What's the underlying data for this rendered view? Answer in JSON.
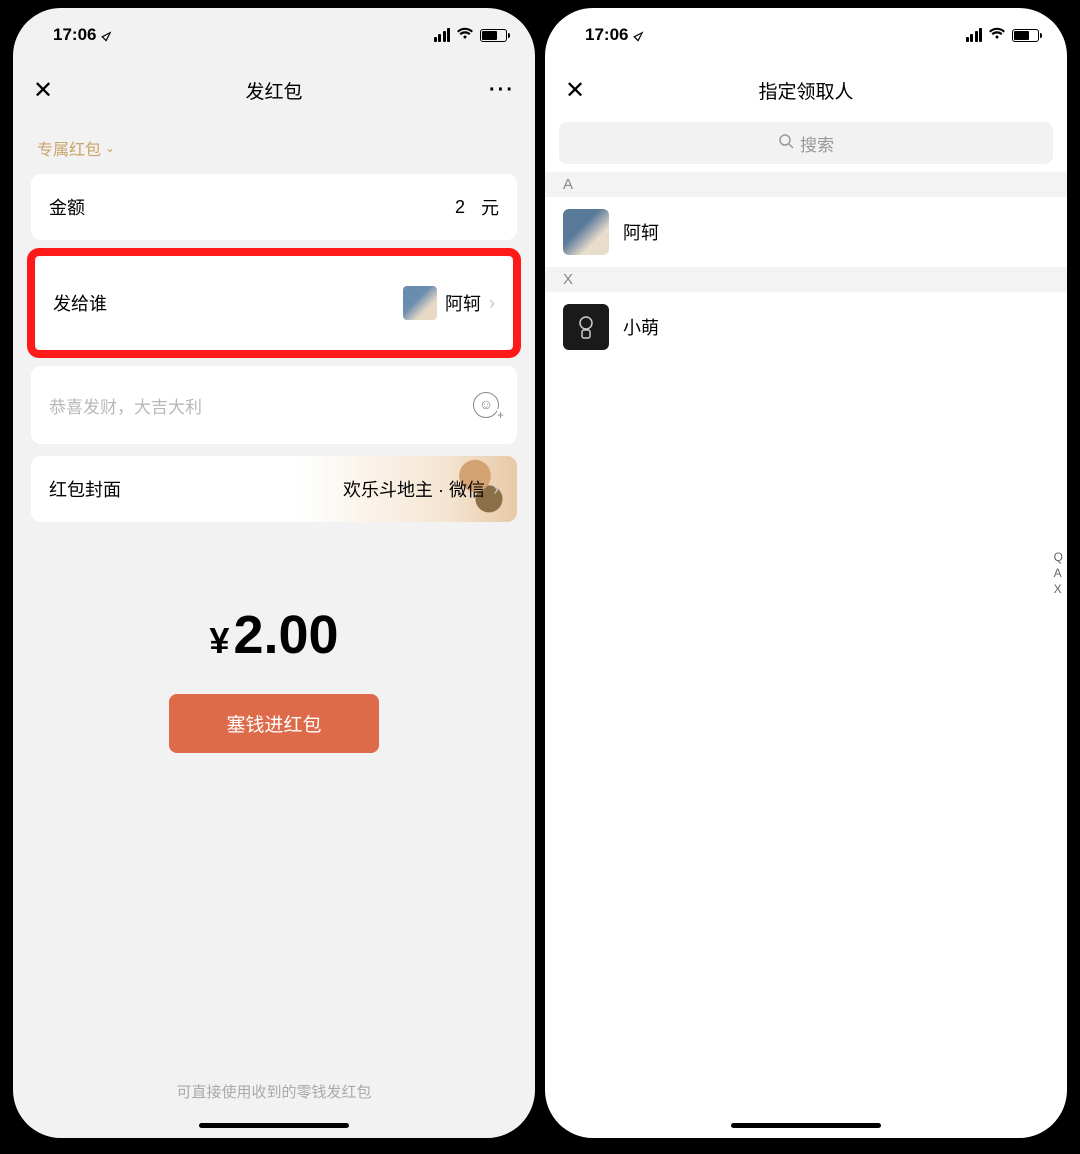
{
  "status": {
    "time": "17:06",
    "location_arrow": "➤"
  },
  "left": {
    "title": "发红包",
    "type_label": "专属红包",
    "amount_label": "金额",
    "amount_value": "2",
    "amount_unit": "元",
    "recipient_label": "发给谁",
    "recipient_name": "阿轲",
    "message_placeholder": "恭喜发财，大吉大利",
    "cover_label": "红包封面",
    "cover_value": "欢乐斗地主 · 微信",
    "total_symbol": "¥",
    "total_value": "2.00",
    "confirm_label": "塞钱进红包",
    "footer_tip": "可直接使用收到的零钱发红包"
  },
  "right": {
    "title": "指定领取人",
    "search_placeholder": "搜索",
    "sections": [
      {
        "letter": "A",
        "name": "阿轲"
      },
      {
        "letter": "X",
        "name": "小萌"
      }
    ],
    "index": [
      "Q",
      "A",
      "X"
    ]
  }
}
